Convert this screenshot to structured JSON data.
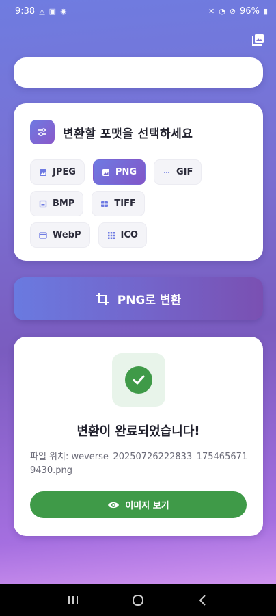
{
  "status_bar": {
    "time": "9:38",
    "battery": "96%"
  },
  "format_card": {
    "title": "변환할 포맷을 선택하세요",
    "formats": [
      {
        "label": "JPEG",
        "selected": false
      },
      {
        "label": "PNG",
        "selected": true
      },
      {
        "label": "GIF",
        "selected": false
      },
      {
        "label": "BMP",
        "selected": false
      },
      {
        "label": "TIFF",
        "selected": false
      },
      {
        "label": "WebP",
        "selected": false
      },
      {
        "label": "ICO",
        "selected": false
      }
    ]
  },
  "convert_button": {
    "label": "PNG로 변환"
  },
  "result_card": {
    "title": "변환이 완료되었습니다!",
    "path": "파일 위치: weverse_20250726222833_1754656719430.png",
    "view_button_label": "이미지 보기"
  },
  "icons": {
    "gallery": "gallery-icon",
    "settings": "sliders-icon",
    "crop": "crop-icon",
    "check": "check-icon",
    "eye": "eye-icon",
    "accent_color": "#6e7ae2",
    "success_color": "#3f9a48"
  }
}
